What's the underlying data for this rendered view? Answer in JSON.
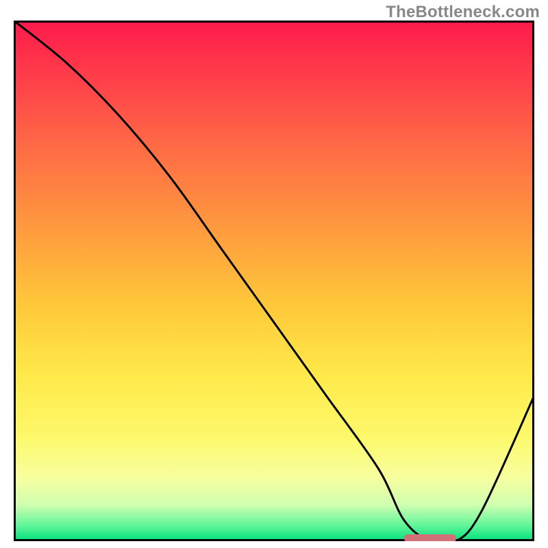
{
  "watermark": "TheBottleneck.com",
  "chart_data": {
    "type": "line",
    "title": "",
    "xlabel": "",
    "ylabel": "",
    "xlim": [
      0,
      100
    ],
    "ylim": [
      0,
      100
    ],
    "series": [
      {
        "name": "curve",
        "x": [
          0,
          10,
          20,
          30,
          40,
          50,
          60,
          70,
          75,
          80,
          85,
          90,
          100
        ],
        "y": [
          100,
          92,
          82,
          70,
          56,
          42,
          28,
          14,
          4,
          0,
          0,
          6,
          28
        ]
      }
    ],
    "minimum_marker": {
      "x_start": 75,
      "x_end": 85,
      "y": 0
    },
    "gradient_stops": [
      {
        "offset": 0.0,
        "color": "#ff1a4b"
      },
      {
        "offset": 0.1,
        "color": "#ff3b4a"
      },
      {
        "offset": 0.25,
        "color": "#ff6d45"
      },
      {
        "offset": 0.4,
        "color": "#ff9a3e"
      },
      {
        "offset": 0.55,
        "color": "#ffc93a"
      },
      {
        "offset": 0.68,
        "color": "#ffe94a"
      },
      {
        "offset": 0.8,
        "color": "#fdf96b"
      },
      {
        "offset": 0.88,
        "color": "#f6ffa0"
      },
      {
        "offset": 0.93,
        "color": "#d0ffb0"
      },
      {
        "offset": 0.97,
        "color": "#61f59a"
      },
      {
        "offset": 1.0,
        "color": "#00e07a"
      }
    ],
    "marker_color": "#d27077",
    "frame_color": "#000000",
    "curve_color": "#000000"
  }
}
